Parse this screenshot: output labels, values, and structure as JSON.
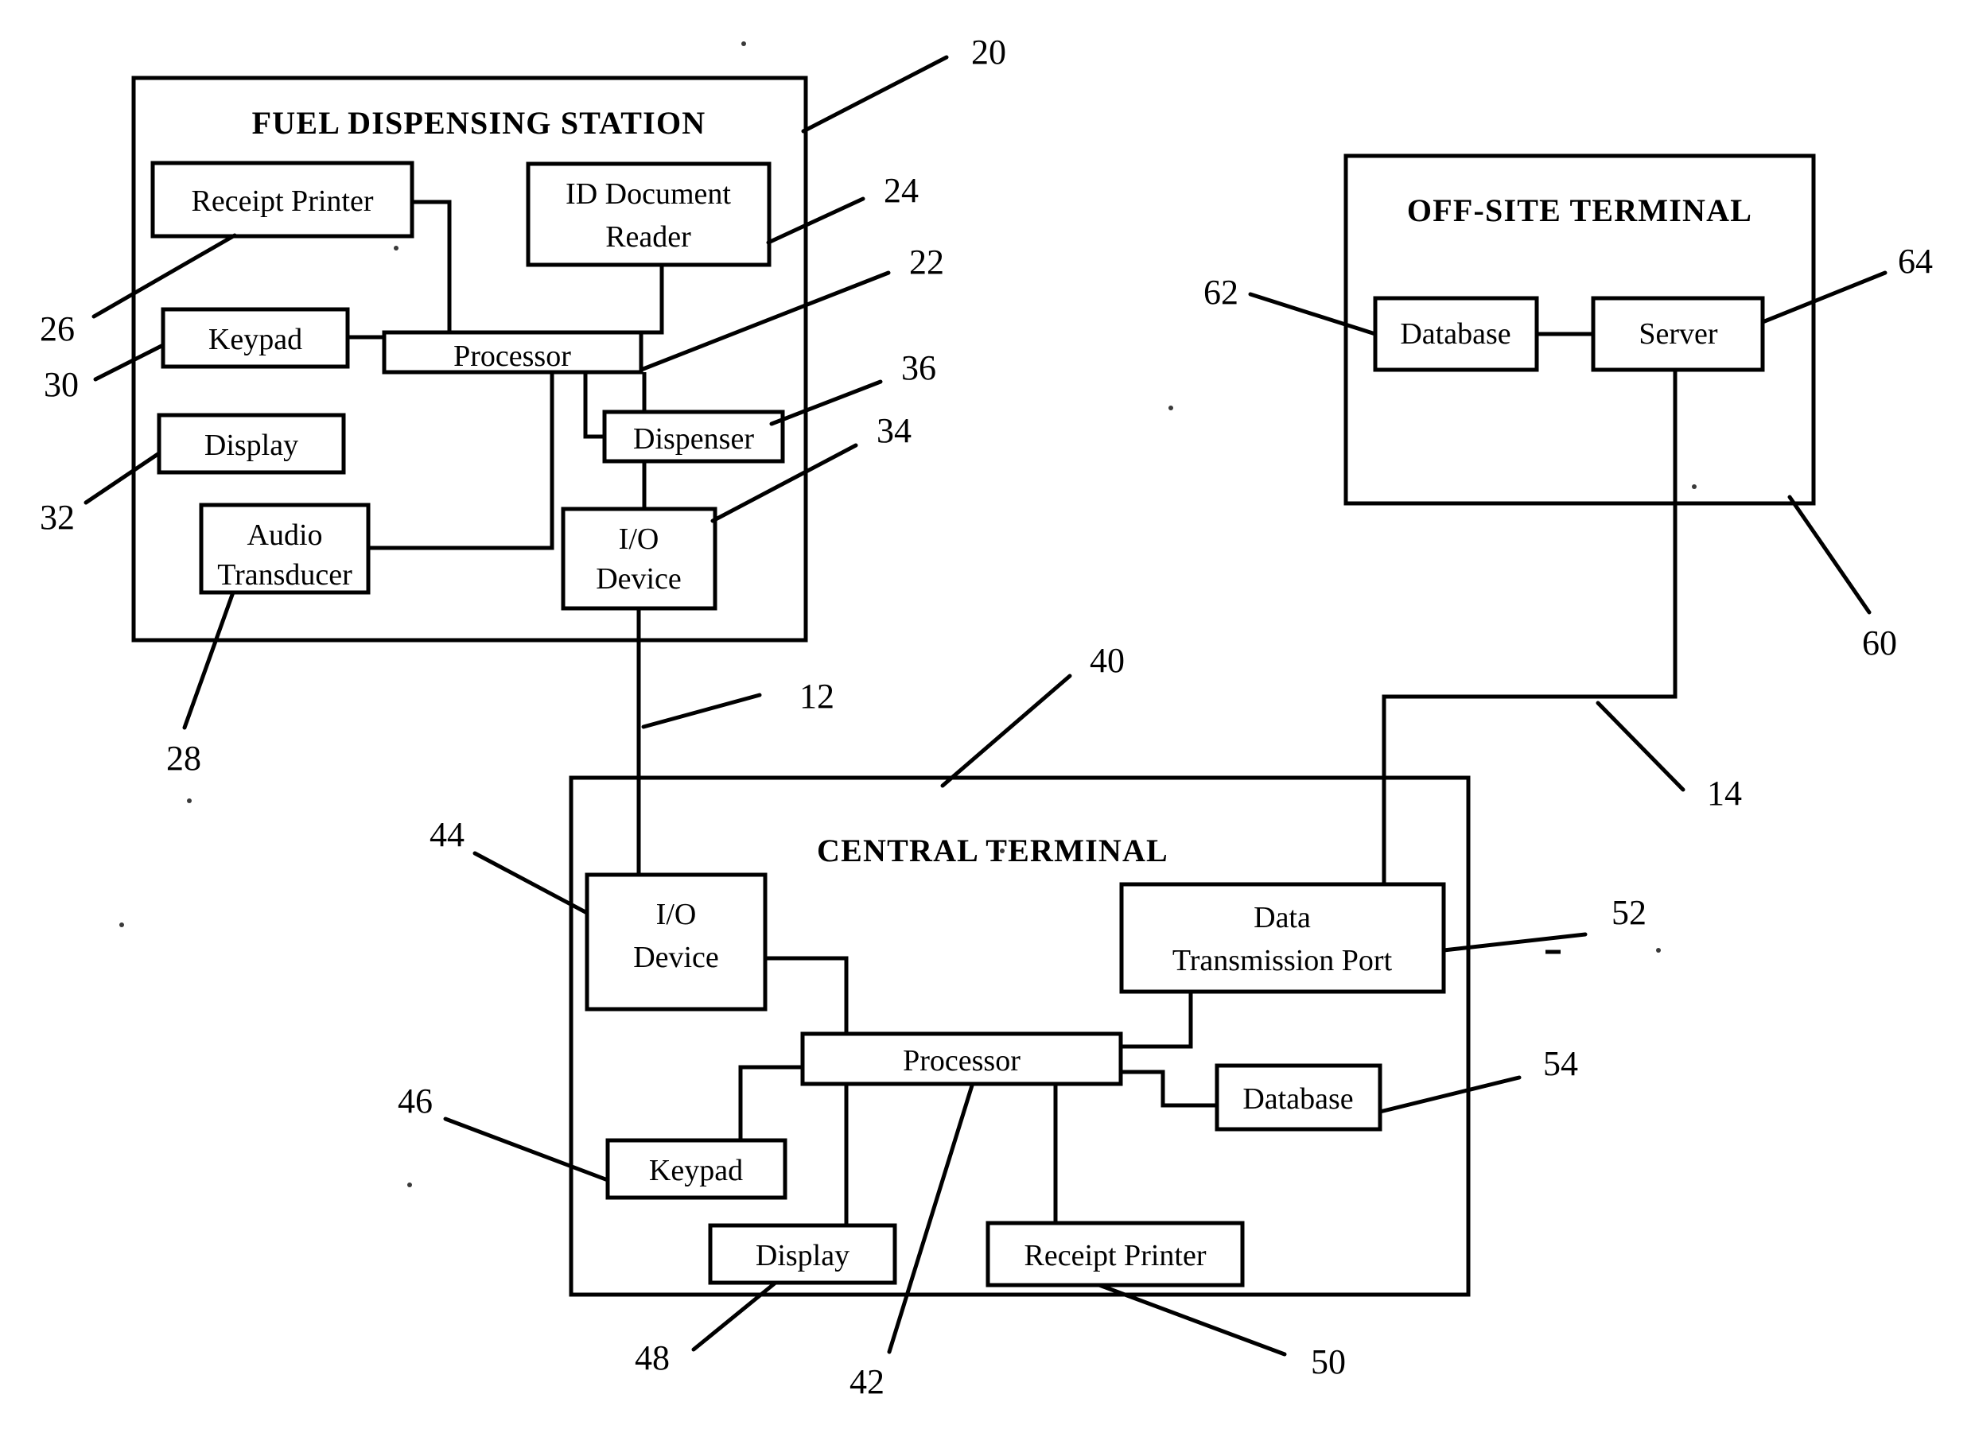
{
  "figure": {
    "type": "patent-block-diagram",
    "groups": [
      {
        "id": "fuel-dispensing-station",
        "title": "FUEL DISPENSING STATION",
        "ref": "20"
      },
      {
        "id": "off-site-terminal",
        "title": "OFF-SITE TERMINAL",
        "ref": "60"
      },
      {
        "id": "central-terminal",
        "title": "CENTRAL TERMINAL",
        "ref": "40"
      }
    ],
    "blocks": {
      "fds_receipt_printer": {
        "label": "Receipt Printer",
        "ref": "26"
      },
      "fds_id_document_reader": {
        "label_line1": "ID Document",
        "label_line2": "Reader",
        "ref": "24"
      },
      "fds_keypad": {
        "label": "Keypad",
        "ref": "30"
      },
      "fds_processor": {
        "label": "Processor",
        "ref": "22"
      },
      "fds_display": {
        "label": "Display",
        "ref": "32"
      },
      "fds_dispenser": {
        "label": "Dispenser",
        "ref": "36"
      },
      "fds_audio_transducer": {
        "label_line1": "Audio",
        "label_line2": "Transducer",
        "ref": "28"
      },
      "fds_io_device": {
        "label_line1": "I/O",
        "label_line2": "Device",
        "ref": "34"
      },
      "ost_database": {
        "label": "Database",
        "ref": "62"
      },
      "ost_server": {
        "label": "Server",
        "ref": "64"
      },
      "ct_io_device": {
        "label_line1": "I/O",
        "label_line2": "Device",
        "ref": "44"
      },
      "ct_data_transmission_port": {
        "label_line1": "Data",
        "label_line2": "Transmission Port",
        "ref": "52"
      },
      "ct_processor": {
        "label": "Processor",
        "ref": "42"
      },
      "ct_database": {
        "label": "Database",
        "ref": "54"
      },
      "ct_keypad": {
        "label": "Keypad",
        "ref": "46"
      },
      "ct_display": {
        "label": "Display",
        "ref": "48"
      },
      "ct_receipt_printer": {
        "label": "Receipt Printer",
        "ref": "50"
      }
    },
    "link_refs": {
      "station_to_central": "12",
      "central_to_offsite": "14"
    },
    "reference_numerals": [
      "20",
      "24",
      "22",
      "36",
      "34",
      "26",
      "30",
      "32",
      "28",
      "12",
      "40",
      "44",
      "46",
      "48",
      "42",
      "50",
      "52",
      "54",
      "62",
      "64",
      "60",
      "14"
    ]
  }
}
